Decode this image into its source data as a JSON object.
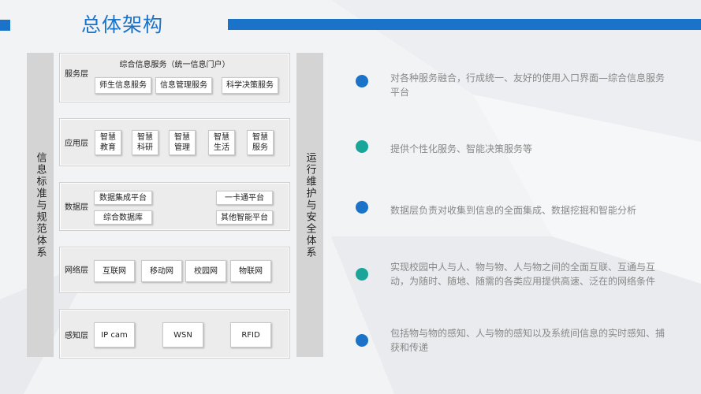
{
  "header": {
    "title": "总体架构"
  },
  "left_column": {
    "label": "信息标准与规范体系"
  },
  "right_column": {
    "label": "运行维护与安全体系"
  },
  "layers": {
    "service": {
      "label": "服务层",
      "title": "综合信息服务（统一信息门户）",
      "items": [
        "师生信息服务",
        "信息管理服务",
        "科学决策服务"
      ]
    },
    "application": {
      "label": "应用层",
      "items": [
        "智慧\n教育",
        "智慧\n科研",
        "智慧\n管理",
        "智慧\n生活",
        "智慧\n服务"
      ]
    },
    "data": {
      "label": "数据层",
      "items": [
        "数据集成平台",
        "综合数据库",
        "一卡通平台",
        "其他智能平台"
      ]
    },
    "network": {
      "label": "网络层",
      "items": [
        "互联网",
        "移动网",
        "校园网",
        "物联网"
      ]
    },
    "perception": {
      "label": "感知层",
      "items": [
        "IP cam",
        "WSN",
        "RFID"
      ]
    }
  },
  "descriptions": [
    {
      "text": "对各种服务融合，行成统一、友好的使用入口界面—综合信息服务平台",
      "color": "#1a73c8"
    },
    {
      "text": "提供个性化服务、智能决策服务等",
      "color": "#1aa59a"
    },
    {
      "text": "数据层负责对收集到信息的全面集成、数据挖掘和智能分析",
      "color": "#1a73c8"
    },
    {
      "text": "实现校园中人与人、物与物、人与物之间的全面互联、互通与互动，为随时、随地、随需的各类应用提供高速、泛在的网络条件",
      "color": "#1aa59a"
    },
    {
      "text": "包括物与物的感知、人与物的感知以及系统间信息的实时感知、捕获和传递",
      "color": "#1a73c8"
    }
  ]
}
